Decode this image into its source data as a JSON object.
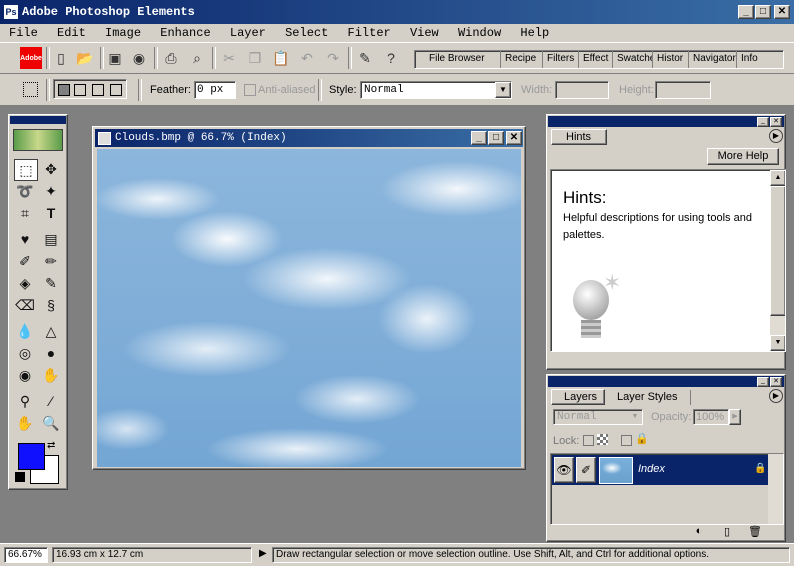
{
  "app": {
    "title": "Adobe Photoshop Elements"
  },
  "menu": [
    "File",
    "Edit",
    "Image",
    "Enhance",
    "Layer",
    "Select",
    "Filter",
    "View",
    "Window",
    "Help"
  ],
  "toolbar": {
    "logo_text": "Adobe",
    "palette_tabs": [
      "File Browser",
      "Recipe",
      "Filters",
      "Effect",
      "Swatche",
      "Histor",
      "Navigator",
      "Info"
    ]
  },
  "options": {
    "feather_label": "Feather:",
    "feather_value": "0 px",
    "antialias_label": "Anti-aliased",
    "style_label": "Style:",
    "style_value": "Normal",
    "width_label": "Width:",
    "height_label": "Height:"
  },
  "document": {
    "title": "Clouds.bmp @ 66.7% (Index)"
  },
  "hints": {
    "tab_label": "Hints",
    "more_help": "More Help",
    "heading": "Hints:",
    "body": "Helpful descriptions for using tools and palettes."
  },
  "layers": {
    "tabs": [
      "Layers",
      "Layer Styles"
    ],
    "blend_mode": "Normal",
    "opacity_label": "Opacity:",
    "opacity_value": "100%",
    "lock_label": "Lock:",
    "layer_name": "Index"
  },
  "colors": {
    "foreground": "#1010ff",
    "background": "#ffffff",
    "titlebar": "#0a246a"
  },
  "status": {
    "zoom": "66.67%",
    "size": "16.93 cm x 12.7 cm",
    "message": "Draw rectangular selection or move selection outline.  Use Shift, Alt, and Ctrl for additional options."
  }
}
